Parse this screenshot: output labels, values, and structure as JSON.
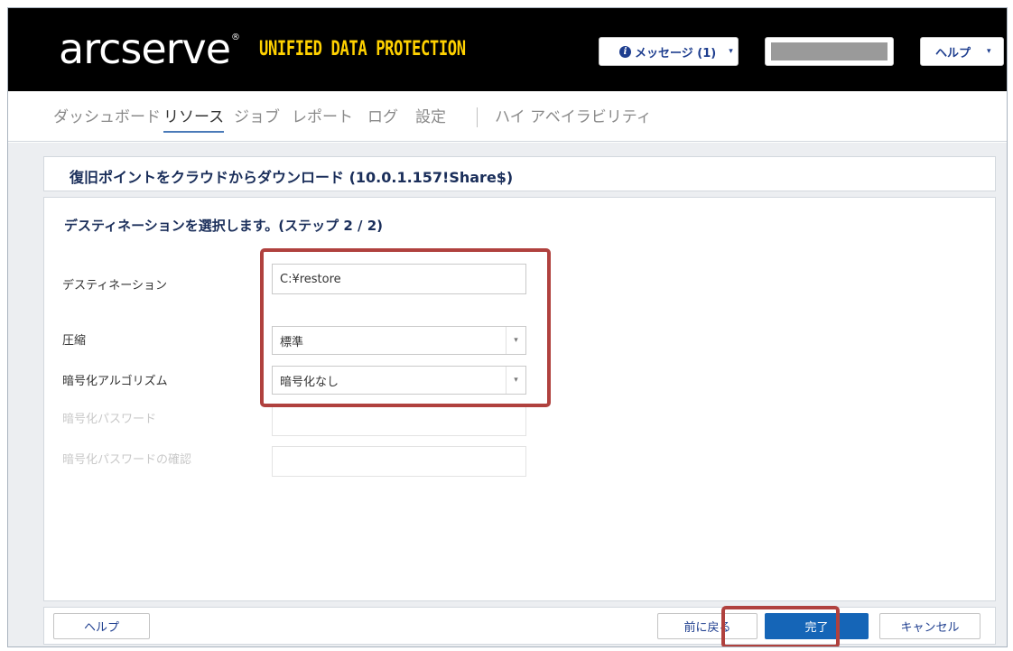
{
  "header": {
    "logo_text": "arcserve",
    "logo_reg": "®",
    "logo_product": "UNIFIED DATA PROTECTION",
    "messages_label": "メッセージ (1)",
    "help_label": "ヘルプ",
    "caret": "▾",
    "info_glyph": "i"
  },
  "nav": {
    "items": [
      {
        "label": "ダッシュボード"
      },
      {
        "label": "リソース"
      },
      {
        "label": "ジョブ"
      },
      {
        "label": "レポート"
      },
      {
        "label": "ログ"
      },
      {
        "label": "設定"
      },
      {
        "label": "ハイ アベイラビリティ"
      }
    ],
    "active": "リソース"
  },
  "wizard": {
    "title": "復旧ポイントをクラウドからダウンロード (10.0.1.157!Share$)",
    "step": "デスティネーションを選択します。(ステップ 2 / 2)",
    "fields": {
      "destination_label": "デスティネーション",
      "destination_value": "C:¥restore",
      "compression_label": "圧縮",
      "compression_value": "標準",
      "algorithm_label": "暗号化アルゴリズム",
      "algorithm_value": "暗号化なし",
      "password_label": "暗号化パスワード",
      "password_confirm_label": "暗号化パスワードの確認"
    }
  },
  "footer": {
    "help": "ヘルプ",
    "back": "前に戻る",
    "finish": "完了",
    "cancel": "キャンセル"
  },
  "colors": {
    "header_bg": "#000000",
    "brand_yellow": "#ffd100",
    "primary_blue": "#1565b7",
    "highlight_red": "#b0413e"
  }
}
